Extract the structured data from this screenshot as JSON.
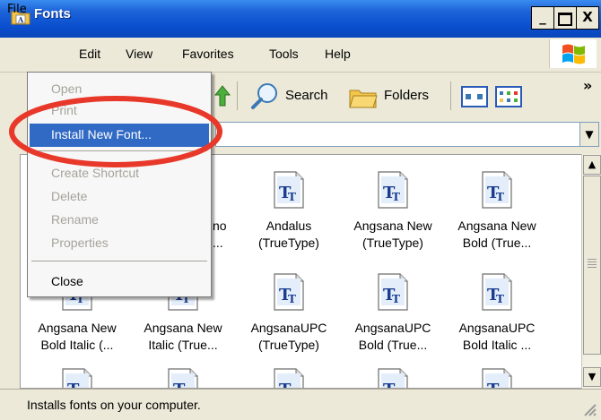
{
  "window": {
    "title": "Fonts"
  },
  "menubar": {
    "items": [
      "File",
      "Edit",
      "View",
      "Favorites",
      "Tools",
      "Help"
    ]
  },
  "toolbar": {
    "search_label": "Search",
    "folders_label": "Folders",
    "overflow": "»"
  },
  "file_menu": {
    "items": [
      {
        "label": "Open",
        "enabled": false
      },
      {
        "label": "Print",
        "enabled": false
      },
      {
        "label": "Install New Font...",
        "enabled": true,
        "highlighted": true
      },
      {
        "label": "Create Shortcut",
        "enabled": false
      },
      {
        "label": "Delete",
        "enabled": false
      },
      {
        "label": "Rename",
        "enabled": false
      },
      {
        "label": "Properties",
        "enabled": false
      },
      {
        "label": "Close",
        "enabled": true
      }
    ]
  },
  "fonts": {
    "row1_partial": [
      "no",
      "..."
    ],
    "items": [
      {
        "line1": "Andalus",
        "line2": "(TrueType)"
      },
      {
        "line1": "Angsana New",
        "line2": "(TrueType)"
      },
      {
        "line1": "Angsana New",
        "line2": "Bold (True..."
      },
      {
        "line1": "Angsana New",
        "line2": "Bold Italic (..."
      },
      {
        "line1": "Angsana New",
        "line2": "Italic (True..."
      },
      {
        "line1": "AngsanaUPC",
        "line2": "(TrueType)"
      },
      {
        "line1": "AngsanaUPC",
        "line2": "Bold (True..."
      },
      {
        "line1": "AngsanaUPC",
        "line2": "Bold Italic ..."
      }
    ]
  },
  "statusbar": {
    "text": "Installs fonts on your computer."
  },
  "colors": {
    "title_bar": "#0a4fcf",
    "menu_highlight": "#316ac5",
    "annotation": "#e8382a"
  }
}
